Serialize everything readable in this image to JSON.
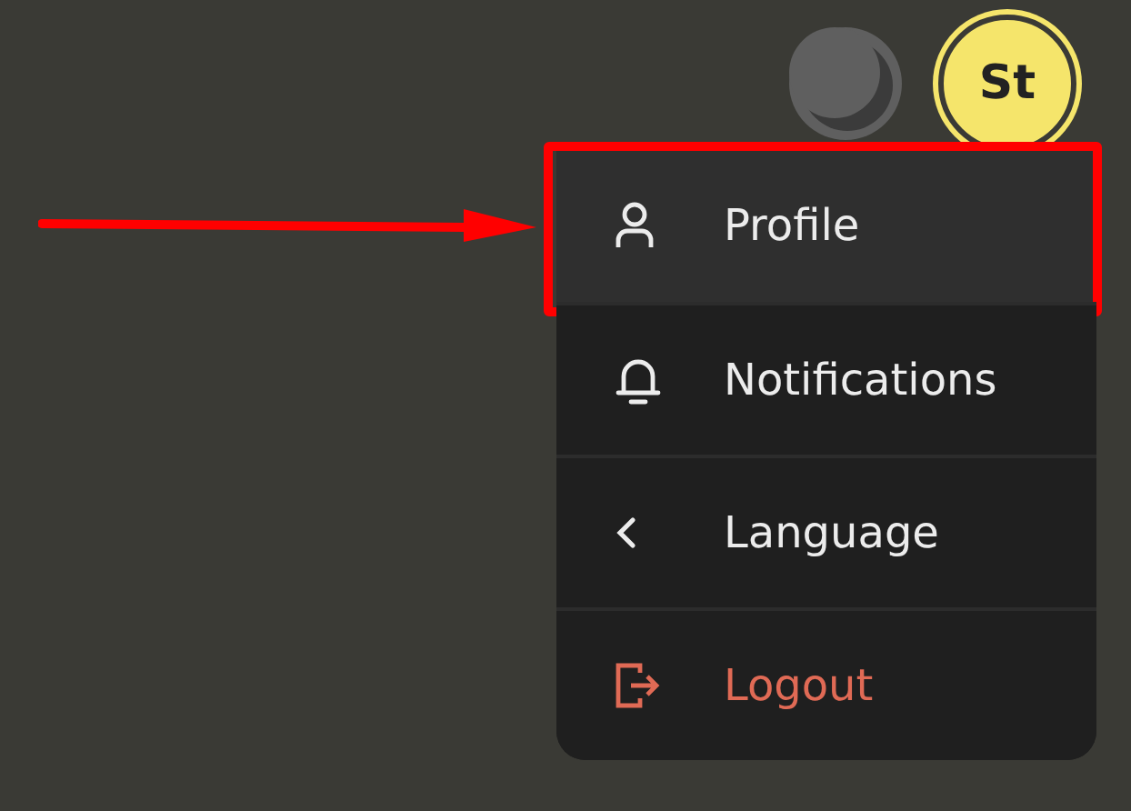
{
  "avatar": {
    "initials": "St"
  },
  "menu": [
    {
      "kind": "profile",
      "label": "Profile",
      "selected": true,
      "callout": true
    },
    {
      "kind": "notifications",
      "label": "Notifications",
      "selected": false,
      "callout": false
    },
    {
      "kind": "language",
      "label": "Language",
      "selected": false,
      "callout": false
    },
    {
      "kind": "logout",
      "label": "Logout",
      "selected": false,
      "callout": false
    }
  ]
}
